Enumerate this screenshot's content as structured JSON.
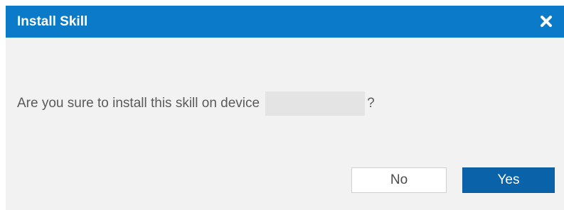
{
  "dialog": {
    "title": "Install Skill",
    "close_icon": "close-icon",
    "message": "Are you sure to install this skill on device",
    "device_name": "",
    "message_suffix": "?",
    "buttons": {
      "no_label": "No",
      "yes_label": "Yes"
    }
  },
  "colors": {
    "header": "#0a7ac9",
    "body": "#f2f2f2",
    "primary_button": "#0a62a8",
    "text": "#5a5a5a"
  }
}
